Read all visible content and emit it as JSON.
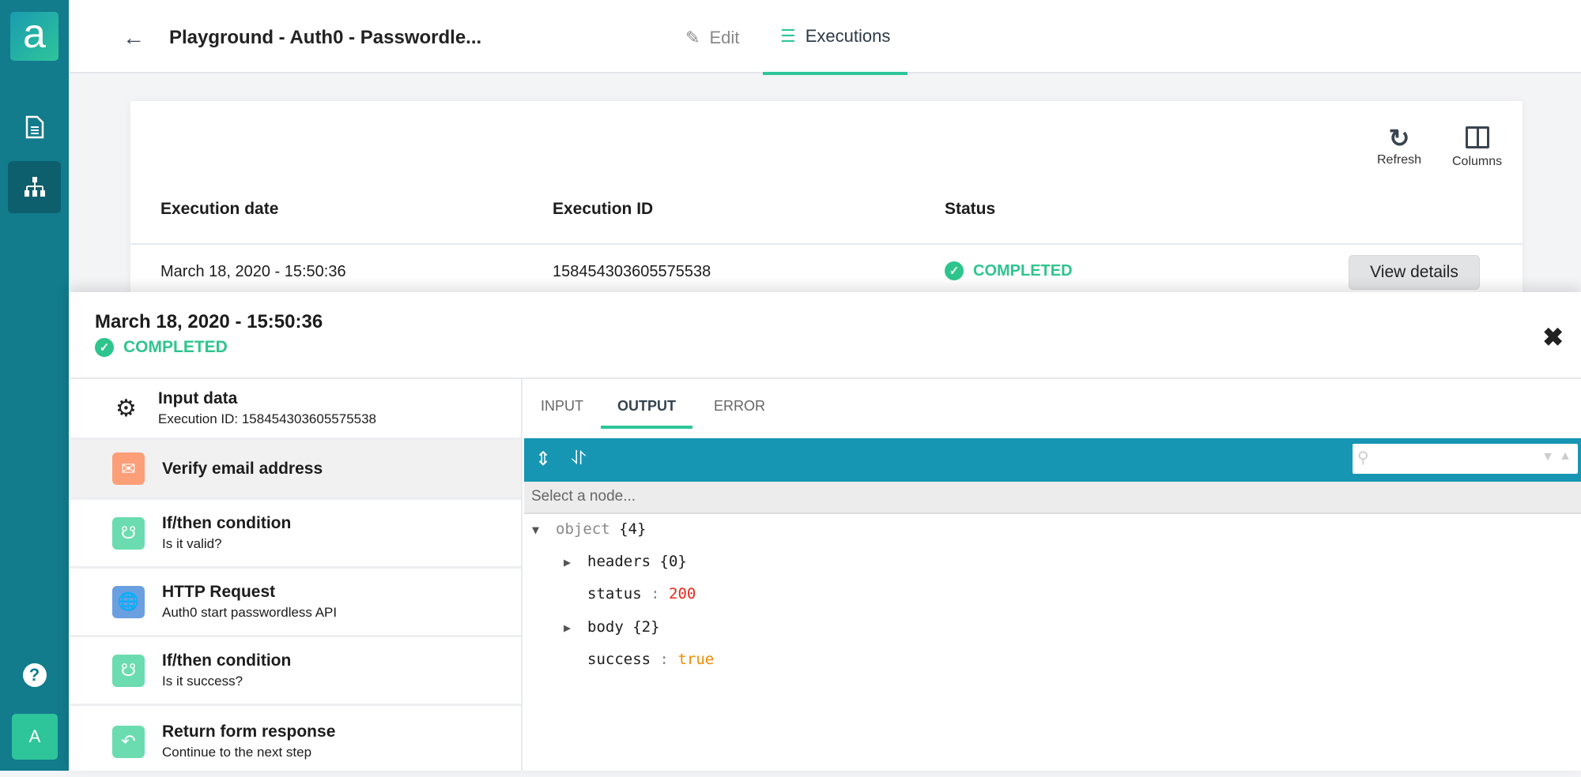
{
  "sidebar": {
    "logo": "a",
    "items": [
      "documents",
      "workflows"
    ],
    "avatar": "A"
  },
  "header": {
    "title": "Playground - Auth0 - Passwordle...",
    "tabs": {
      "edit": "Edit",
      "executions": "Executions"
    }
  },
  "toolbar": {
    "refresh": "Refresh",
    "columns": "Columns"
  },
  "table": {
    "columns": [
      "Execution date",
      "Execution ID",
      "Status"
    ],
    "rows": [
      {
        "date": "March 18, 2020 - 15:50:36",
        "id": "158454303605575538",
        "status": "COMPLETED",
        "action": "View details"
      }
    ]
  },
  "panel": {
    "title": "March 18, 2020 - 15:50:36",
    "status": "COMPLETED",
    "steps": [
      {
        "name": "Input data",
        "sub": "Execution ID: 158454303605575538",
        "icon": "gears-icon"
      },
      {
        "name": "Verify email address",
        "sub": "",
        "icon": "email-verify-icon",
        "color": "#fc9f78"
      },
      {
        "name": "If/then condition",
        "sub": "Is it valid?",
        "icon": "branch-icon",
        "color": "#6bdcb0"
      },
      {
        "name": "HTTP Request",
        "sub": "Auth0 start passwordless API",
        "icon": "globe-icon",
        "color": "#6a9fe0"
      },
      {
        "name": "If/then condition",
        "sub": "Is it success?",
        "icon": "branch-icon",
        "color": "#6bdcb0"
      },
      {
        "name": "Return form response",
        "sub": "Continue to the next step",
        "icon": "reply-icon",
        "color": "#6bdcb0"
      }
    ],
    "tabs": [
      "INPUT",
      "OUTPUT",
      "ERROR"
    ],
    "select_node": "Select a node...",
    "tree": {
      "root": "object",
      "root_count": "{4}",
      "headers": "headers",
      "headers_count": "{0}",
      "status_key": "status",
      "status_val": "200",
      "body": "body",
      "body_count": "{2}",
      "success_key": "success",
      "success_val": "true",
      "sep": ":"
    }
  },
  "colors": {
    "accent": "#2ec59a",
    "sidebar": "#127b8c",
    "toolbar": "#1796b4",
    "number": "#e8281c",
    "boolean": "#f08a00"
  }
}
